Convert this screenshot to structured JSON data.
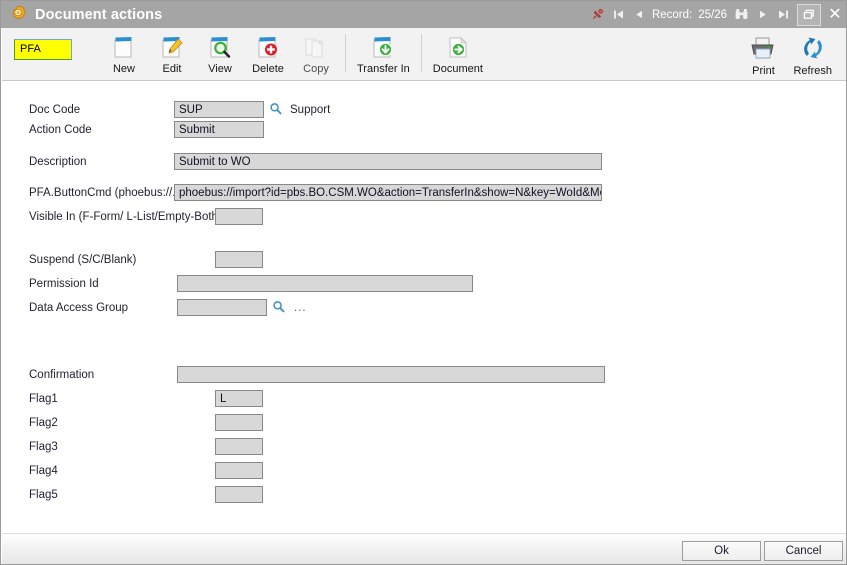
{
  "window": {
    "title": "Document actions",
    "icon": "gear-icon",
    "record_label": "Record:",
    "record_value": "25/26",
    "pin_icon": "pin-icon",
    "first_icon": "first-record-icon",
    "prev_icon": "previous-record-icon",
    "find_icon": "binoculars-find-icon",
    "next_icon": "next-record-icon",
    "last_icon": "last-record-icon",
    "restore_icon": "restore-window-icon",
    "close_icon": "close-window-icon"
  },
  "toolbar": {
    "badge": "PFA",
    "items": [
      {
        "label": "New",
        "icon": "new-document-icon"
      },
      {
        "label": "Edit",
        "icon": "edit-pencil-icon"
      },
      {
        "label": "View",
        "icon": "view-magnifier-icon"
      },
      {
        "label": "Delete",
        "icon": "delete-document-icon"
      },
      {
        "label": "Copy",
        "icon": "copy-document-icon"
      },
      {
        "label": "Transfer In",
        "icon": "transfer-in-icon"
      },
      {
        "label": "Document",
        "icon": "document-icon"
      }
    ],
    "right_items": [
      {
        "label": "Print",
        "icon": "printer-icon"
      },
      {
        "label": "Refresh",
        "icon": "refresh-arrows-icon"
      }
    ]
  },
  "form": {
    "doc_code": {
      "label": "Doc Code",
      "value": "SUP",
      "lookup_icon": "magnifier-lookup-icon",
      "description": "Support"
    },
    "action_code": {
      "label": "Action Code",
      "value": "Submit"
    },
    "description": {
      "label": "Description",
      "value": "Submit to WO"
    },
    "button_cmd": {
      "label": "PFA.ButtonCmd   (phoebus://....)",
      "value": "phoebus://import?id=pbs.BO.CSM.WO&action=TransferIn&show=N&key=WoId&Mode=I"
    },
    "visible_in": {
      "label": "Visible In   (F-Form/ L-List/Empty-Both)",
      "value": ""
    },
    "suspend": {
      "label": "Suspend  (S/C/Blank)",
      "value": ""
    },
    "permission_id": {
      "label": "Permission Id",
      "value": ""
    },
    "data_access_group": {
      "label": "Data Access Group",
      "value": "",
      "lookup_icon": "magnifier-lookup-icon",
      "more": "..."
    },
    "confirmation": {
      "label": "Confirmation",
      "value": ""
    },
    "flags": [
      {
        "label": "Flag1",
        "value": "L"
      },
      {
        "label": "Flag2",
        "value": ""
      },
      {
        "label": "Flag3",
        "value": ""
      },
      {
        "label": "Flag4",
        "value": ""
      },
      {
        "label": "Flag5",
        "value": ""
      }
    ]
  },
  "footer": {
    "ok": "Ok",
    "cancel": "Cancel"
  }
}
